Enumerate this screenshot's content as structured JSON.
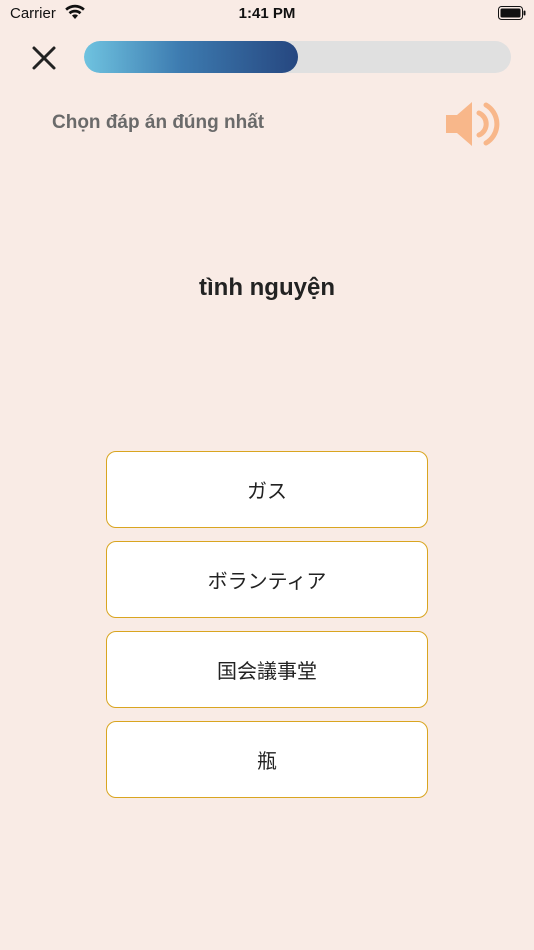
{
  "status_bar": {
    "carrier": "Carrier",
    "time": "1:41 PM"
  },
  "progress": {
    "fraction": 0.5
  },
  "quiz": {
    "instruction": "Chọn đáp án đúng nhất",
    "question_word": "tình nguyện",
    "options": [
      {
        "label": "ガス"
      },
      {
        "label": "ボランティア"
      },
      {
        "label": "国会議事堂"
      },
      {
        "label": "瓶"
      }
    ]
  },
  "icons": {
    "close": "close-icon",
    "speaker": "speaker-icon",
    "wifi": "wifi-icon",
    "battery": "battery-icon"
  },
  "colors": {
    "background": "#f9ebe5",
    "speaker": "#f8b78a",
    "option_border": "#d9a520",
    "progress_start": "#6fc3e0",
    "progress_end": "#264780"
  }
}
